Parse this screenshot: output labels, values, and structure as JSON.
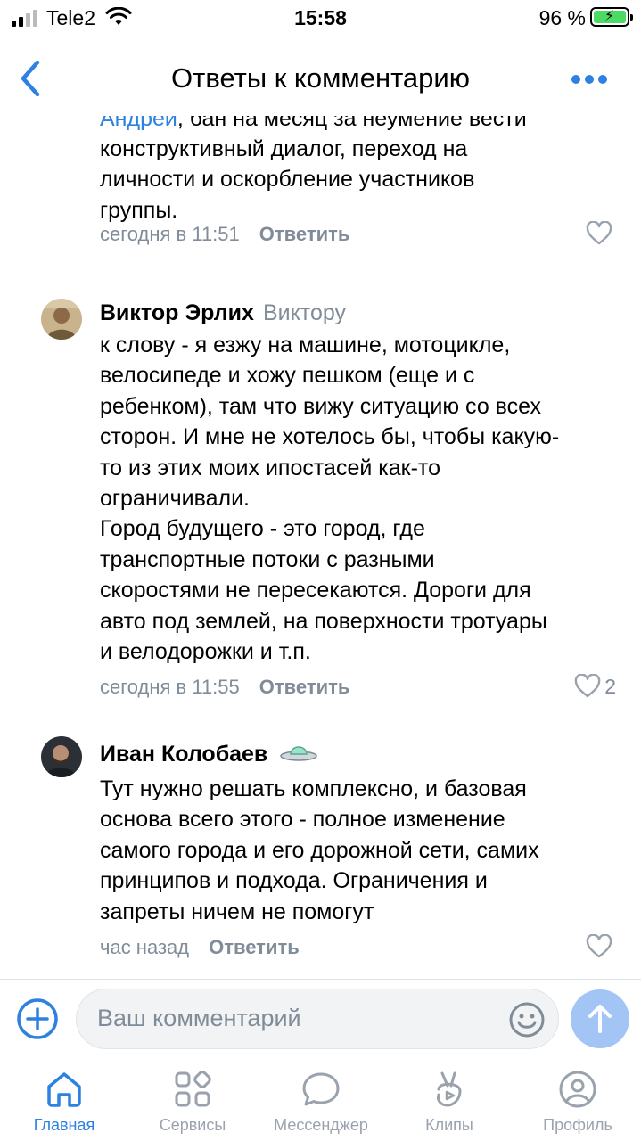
{
  "status_bar": {
    "carrier": "Tele2",
    "time": "15:58",
    "battery": "96 %"
  },
  "header": {
    "title": "Ответы к комментарию",
    "back_icon": "chevron-left-icon",
    "more_icon": "more-horizontal-icon"
  },
  "comments": [
    {
      "text_mention": "Андрей",
      "text_head": ", бан на месяц за неумение вести",
      "text": "конструктивный диалог, переход на\nличности и оскорбление участников\nгруппы.",
      "time": "сегодня в 11:51",
      "reply_label": "Ответить",
      "likes": ""
    },
    {
      "author": "Виктор Эрлих",
      "reply_to": "Виктору",
      "text": "к слову - я езжу на машине, мотоцикле,\nвелосипеде и хожу пешком (еще и с\nребенком), там что вижу ситуацию со всех\nсторон. И мне не хотелось бы, чтобы какую-\nто из этих моих ипостасей как-то\nограничивали.\nГород будущего - это город, где\nтранспортные потоки с разными\nскоростями не пересекаются. Дороги для\nавто под землей, на поверхности тротуары\nи велодорожки и т.п.",
      "time": "сегодня в 11:55",
      "reply_label": "Ответить",
      "likes": "2"
    },
    {
      "author": "Иван Колобаев",
      "text": "Тут нужно решать комплексно, и базовая\nоснова всего этого - полное изменение\nсамого города и его дорожной сети, самих\nпринципов и подхода. Ограничения и\nзапреты ничем не помогут",
      "time": "час назад",
      "reply_label": "Ответить",
      "likes": ""
    }
  ],
  "input": {
    "placeholder": "Ваш комментарий"
  },
  "tabs": [
    {
      "label": "Главная",
      "icon": "home-icon",
      "active": true
    },
    {
      "label": "Сервисы",
      "icon": "services-icon",
      "active": false
    },
    {
      "label": "Мессенджер",
      "icon": "messenger-icon",
      "active": false
    },
    {
      "label": "Клипы",
      "icon": "clips-icon",
      "active": false
    },
    {
      "label": "Профиль",
      "icon": "profile-icon",
      "active": false
    }
  ],
  "colors": {
    "accent": "#2d81e0",
    "secondary_text": "#818c99",
    "send_button": "#a3c5f5"
  }
}
